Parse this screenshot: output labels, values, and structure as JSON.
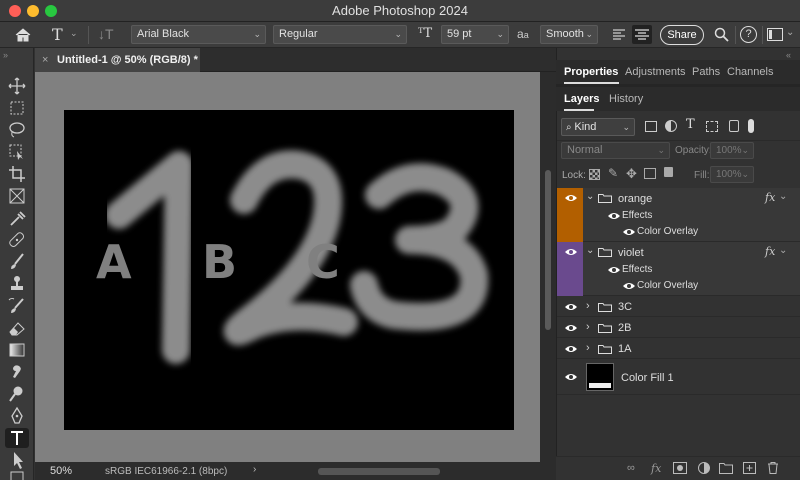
{
  "app": {
    "title": "Adobe Photoshop 2024"
  },
  "options": {
    "font_family": "Arial Black",
    "font_style": "Regular",
    "font_size": "59 pt",
    "antialias": "Smooth",
    "aa_label": "a",
    "share": "Share"
  },
  "document": {
    "tab_title": "Untitled-1 @ 50% (RGB/8) *",
    "close_glyph": "×",
    "zoom": "50%",
    "profile": "sRGB IEC61966-2.1 (8bpc)",
    "canvas_letters": [
      "A",
      "B",
      "C"
    ],
    "canvas_numbers": [
      "1",
      "2",
      "3"
    ]
  },
  "panels": {
    "top_tabs": [
      "Properties",
      "Adjustments",
      "Paths",
      "Channels"
    ],
    "sub_tabs": [
      "Layers",
      "History"
    ],
    "filter_kind": "Kind",
    "blend_mode": "Normal",
    "opacity_label": "Opacity:",
    "opacity_value": "100%",
    "lock_label": "Lock:",
    "fill_label": "Fill:",
    "fill_value": "100%"
  },
  "layers": [
    {
      "name": "orange",
      "type": "group",
      "expanded": true,
      "color": "#b25f00",
      "effects_label": "Effects",
      "effect": "Color Overlay",
      "fx": "fx"
    },
    {
      "name": "violet",
      "type": "group",
      "expanded": true,
      "color": "#6a4a8e",
      "effects_label": "Effects",
      "effect": "Color Overlay",
      "fx": "fx"
    },
    {
      "name": "3C",
      "type": "group",
      "expanded": false
    },
    {
      "name": "2B",
      "type": "group",
      "expanded": false
    },
    {
      "name": "1A",
      "type": "group",
      "expanded": false
    },
    {
      "name": "Color Fill 1",
      "type": "fill"
    }
  ],
  "colors": {
    "accent_orange": "#b25f00",
    "accent_violet": "#6a4a8e",
    "canvas_bg": "#000000",
    "text_gray": "#808080"
  }
}
